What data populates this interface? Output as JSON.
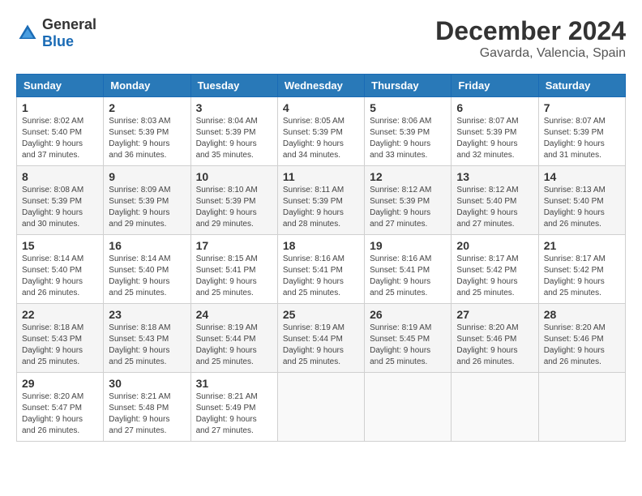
{
  "header": {
    "logo_general": "General",
    "logo_blue": "Blue",
    "month_year": "December 2024",
    "location": "Gavarda, Valencia, Spain"
  },
  "weekdays": [
    "Sunday",
    "Monday",
    "Tuesday",
    "Wednesday",
    "Thursday",
    "Friday",
    "Saturday"
  ],
  "weeks": [
    [
      {
        "day": "1",
        "info": "Sunrise: 8:02 AM\nSunset: 5:40 PM\nDaylight: 9 hours\nand 37 minutes."
      },
      {
        "day": "2",
        "info": "Sunrise: 8:03 AM\nSunset: 5:39 PM\nDaylight: 9 hours\nand 36 minutes."
      },
      {
        "day": "3",
        "info": "Sunrise: 8:04 AM\nSunset: 5:39 PM\nDaylight: 9 hours\nand 35 minutes."
      },
      {
        "day": "4",
        "info": "Sunrise: 8:05 AM\nSunset: 5:39 PM\nDaylight: 9 hours\nand 34 minutes."
      },
      {
        "day": "5",
        "info": "Sunrise: 8:06 AM\nSunset: 5:39 PM\nDaylight: 9 hours\nand 33 minutes."
      },
      {
        "day": "6",
        "info": "Sunrise: 8:07 AM\nSunset: 5:39 PM\nDaylight: 9 hours\nand 32 minutes."
      },
      {
        "day": "7",
        "info": "Sunrise: 8:07 AM\nSunset: 5:39 PM\nDaylight: 9 hours\nand 31 minutes."
      }
    ],
    [
      {
        "day": "8",
        "info": "Sunrise: 8:08 AM\nSunset: 5:39 PM\nDaylight: 9 hours\nand 30 minutes."
      },
      {
        "day": "9",
        "info": "Sunrise: 8:09 AM\nSunset: 5:39 PM\nDaylight: 9 hours\nand 29 minutes."
      },
      {
        "day": "10",
        "info": "Sunrise: 8:10 AM\nSunset: 5:39 PM\nDaylight: 9 hours\nand 29 minutes."
      },
      {
        "day": "11",
        "info": "Sunrise: 8:11 AM\nSunset: 5:39 PM\nDaylight: 9 hours\nand 28 minutes."
      },
      {
        "day": "12",
        "info": "Sunrise: 8:12 AM\nSunset: 5:39 PM\nDaylight: 9 hours\nand 27 minutes."
      },
      {
        "day": "13",
        "info": "Sunrise: 8:12 AM\nSunset: 5:40 PM\nDaylight: 9 hours\nand 27 minutes."
      },
      {
        "day": "14",
        "info": "Sunrise: 8:13 AM\nSunset: 5:40 PM\nDaylight: 9 hours\nand 26 minutes."
      }
    ],
    [
      {
        "day": "15",
        "info": "Sunrise: 8:14 AM\nSunset: 5:40 PM\nDaylight: 9 hours\nand 26 minutes."
      },
      {
        "day": "16",
        "info": "Sunrise: 8:14 AM\nSunset: 5:40 PM\nDaylight: 9 hours\nand 25 minutes."
      },
      {
        "day": "17",
        "info": "Sunrise: 8:15 AM\nSunset: 5:41 PM\nDaylight: 9 hours\nand 25 minutes."
      },
      {
        "day": "18",
        "info": "Sunrise: 8:16 AM\nSunset: 5:41 PM\nDaylight: 9 hours\nand 25 minutes."
      },
      {
        "day": "19",
        "info": "Sunrise: 8:16 AM\nSunset: 5:41 PM\nDaylight: 9 hours\nand 25 minutes."
      },
      {
        "day": "20",
        "info": "Sunrise: 8:17 AM\nSunset: 5:42 PM\nDaylight: 9 hours\nand 25 minutes."
      },
      {
        "day": "21",
        "info": "Sunrise: 8:17 AM\nSunset: 5:42 PM\nDaylight: 9 hours\nand 25 minutes."
      }
    ],
    [
      {
        "day": "22",
        "info": "Sunrise: 8:18 AM\nSunset: 5:43 PM\nDaylight: 9 hours\nand 25 minutes."
      },
      {
        "day": "23",
        "info": "Sunrise: 8:18 AM\nSunset: 5:43 PM\nDaylight: 9 hours\nand 25 minutes."
      },
      {
        "day": "24",
        "info": "Sunrise: 8:19 AM\nSunset: 5:44 PM\nDaylight: 9 hours\nand 25 minutes."
      },
      {
        "day": "25",
        "info": "Sunrise: 8:19 AM\nSunset: 5:44 PM\nDaylight: 9 hours\nand 25 minutes."
      },
      {
        "day": "26",
        "info": "Sunrise: 8:19 AM\nSunset: 5:45 PM\nDaylight: 9 hours\nand 25 minutes."
      },
      {
        "day": "27",
        "info": "Sunrise: 8:20 AM\nSunset: 5:46 PM\nDaylight: 9 hours\nand 26 minutes."
      },
      {
        "day": "28",
        "info": "Sunrise: 8:20 AM\nSunset: 5:46 PM\nDaylight: 9 hours\nand 26 minutes."
      }
    ],
    [
      {
        "day": "29",
        "info": "Sunrise: 8:20 AM\nSunset: 5:47 PM\nDaylight: 9 hours\nand 26 minutes."
      },
      {
        "day": "30",
        "info": "Sunrise: 8:21 AM\nSunset: 5:48 PM\nDaylight: 9 hours\nand 27 minutes."
      },
      {
        "day": "31",
        "info": "Sunrise: 8:21 AM\nSunset: 5:49 PM\nDaylight: 9 hours\nand 27 minutes."
      },
      {
        "day": "",
        "info": ""
      },
      {
        "day": "",
        "info": ""
      },
      {
        "day": "",
        "info": ""
      },
      {
        "day": "",
        "info": ""
      }
    ]
  ]
}
